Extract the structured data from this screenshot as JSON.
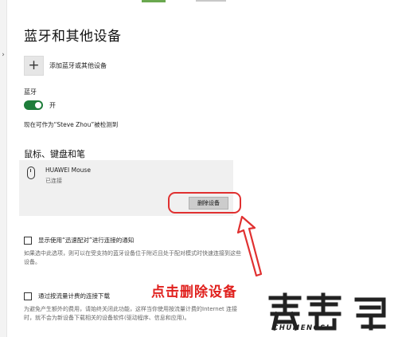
{
  "page": {
    "title": "蓝牙和其他设备"
  },
  "add_device": {
    "label": "添加蓝牙或其他设备"
  },
  "bluetooth": {
    "label": "蓝牙",
    "toggle_on": true,
    "state_label": "开",
    "discoverable_text": "现在可作为“Steve Zhou”被检测到"
  },
  "devices_section": {
    "title": "鼠标、键盘和笔",
    "devices": [
      {
        "name": "HUAWEI  Mouse",
        "status": "已连接"
      }
    ],
    "remove_button_label": "删除设备"
  },
  "swift_pair": {
    "label": "显示使用“迅速配对”进行连接的通知",
    "checked": false,
    "description": "如果选中此选项，则可以在受支持的蓝牙设备位于附近且处于配对模式时快速连接到这些设备。"
  },
  "metered": {
    "label": "通过按流量计费的连接下载",
    "checked": false,
    "description": "为避免产生额外的费用，请始终关闭此功能，这样当你使用按流量计费的Internet 连接时，就不会为新设备下载相关的设备软件(驱动程序、信息和应用)。"
  },
  "annotation": {
    "text": "点击删除设备"
  },
  "watermark": {
    "text": "CHUMENGSI"
  },
  "colors": {
    "toggle_on": "#1e7d3a",
    "highlight": "#e03030",
    "annotation": "#e0201d"
  }
}
